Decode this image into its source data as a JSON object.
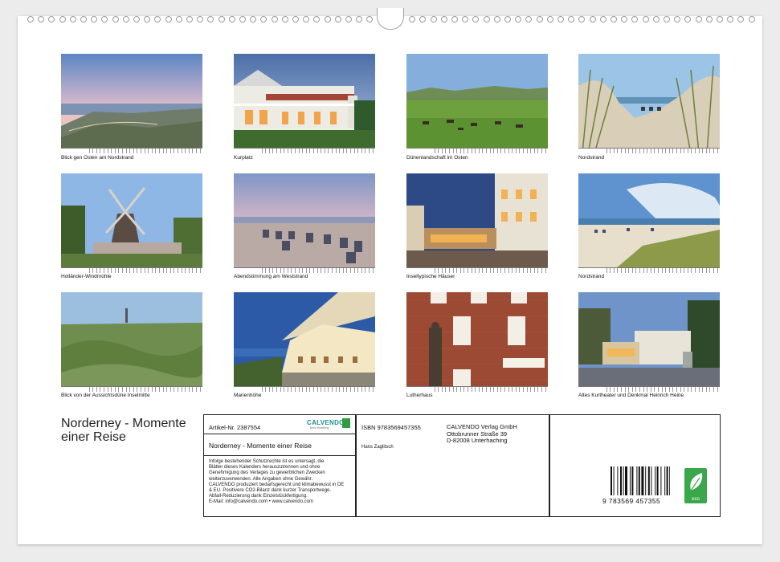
{
  "photos": [
    {
      "caption": "Blick gen Osten am Nordstrand",
      "scene": "dunes-dusk"
    },
    {
      "caption": "Kurplatz",
      "scene": "kurplatz"
    },
    {
      "caption": "Dünenlandschaft im Osten",
      "scene": "horses"
    },
    {
      "caption": "Nordstrand",
      "scene": "beach-grass"
    },
    {
      "caption": "Holländer-Windmühle",
      "scene": "windmill"
    },
    {
      "caption": "Abendstimmung am Weststrand",
      "scene": "beach-chairs"
    },
    {
      "caption": "Inseltypische Häuser",
      "scene": "street-night"
    },
    {
      "caption": "Nordstrand",
      "scene": "beach-day"
    },
    {
      "caption": "Blick von der Aussichtsdüne Inselmitte",
      "scene": "green-dunes"
    },
    {
      "caption": "Marienhöhe",
      "scene": "marienhoehe"
    },
    {
      "caption": "Lutherhaus",
      "scene": "lutherhaus"
    },
    {
      "caption": "Altes Kurtheater und Denkmal Heinrich Heine",
      "scene": "kurtheater"
    }
  ],
  "calendar_title_line1": "Norderney - Momente",
  "calendar_title_line2": "einer Reise",
  "info": {
    "article": "Artikel-Nr. 2387554",
    "brand": "CALVENDO",
    "brand_sub": "Best Marketing",
    "title": "Norderney - Momente einer Reise",
    "isbn": "ISBN 9783569457355",
    "author": "Hans Zaglitsch",
    "publisher_lines": [
      "CALVENDO Verlag GmbH",
      "Ottobrunner Straße 39",
      "D-82008 Unterhaching"
    ],
    "legal_lines": [
      "Infolge bestehender Schutzrechte ist es untersagt, die",
      "Blätter dieses Kalenders herauszutrennen und ohne",
      "Genehmigung des Verlages zu gewerblichen Zwecken",
      "weiterzuverwenden. Alle Angaben ohne Gewähr.",
      "CALVENDO produziert bedarfsgerecht und klimabewusst in DE",
      "& EU. Positivere CO2-Bilanz dank kurzer Transportwege.",
      "Abfall-Reduzierung dank Einzelstückfertigung.",
      "E-Mail: info@calvendo.com • www.calvendo.com"
    ],
    "barcode_digits": "9 783569 457355",
    "eco_label": "eco"
  },
  "colors": {
    "accent_green": "#2e9e3e",
    "calvendo_teal": "#1b8f8f",
    "border": "#222222"
  }
}
